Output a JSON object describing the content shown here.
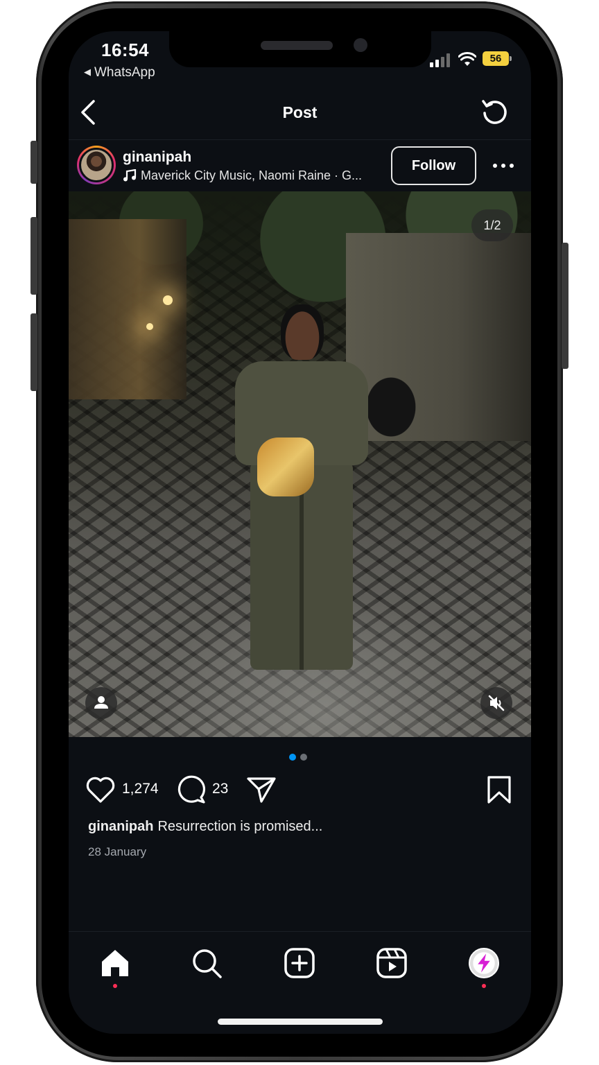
{
  "status_bar": {
    "time": "16:54",
    "back_app": "WhatsApp",
    "battery": "56"
  },
  "header": {
    "title": "Post"
  },
  "post": {
    "username": "ginanipah",
    "audio": "Maverick City Music, Naomi Raine · G...",
    "follow_label": "Follow",
    "image_counter": "1/2",
    "carousel": {
      "current": 1,
      "total": 2
    },
    "likes": "1,274",
    "comments": "23",
    "caption_user": "ginanipah",
    "caption_text": "Resurrection is promised...",
    "date": "28 January"
  },
  "icons": {
    "header": [
      "back-arrow-icon",
      "refresh-icon"
    ],
    "actions": [
      "heart-icon",
      "comment-icon",
      "share-icon",
      "bookmark-icon"
    ],
    "nav": [
      "home-icon",
      "search-icon",
      "create-icon",
      "reels-icon",
      "profile-icon"
    ]
  },
  "colors": {
    "background": "#0c0f14",
    "accent_dot": "#0095f6",
    "notification_dot": "#ff2d55",
    "battery": "#f4d03f"
  }
}
